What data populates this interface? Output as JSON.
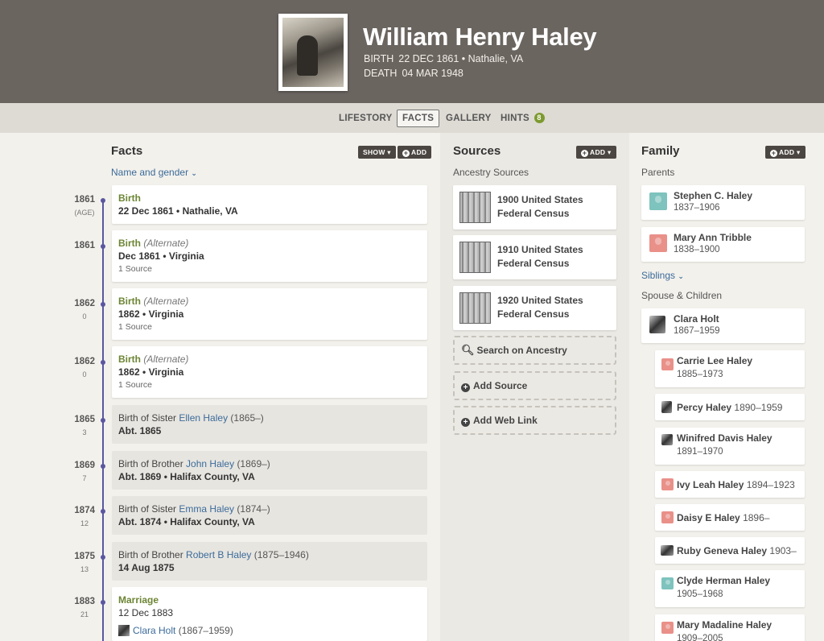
{
  "person": {
    "name": "William Henry Haley",
    "birth_label": "BIRTH",
    "birth_value": "22 DEC 1861 • Nathalie, VA",
    "death_label": "DEATH",
    "death_value": "04 MAR 1948"
  },
  "tabs": [
    {
      "label": "LIFESTORY"
    },
    {
      "label": "FACTS"
    },
    {
      "label": "GALLERY"
    },
    {
      "label": "HINTS",
      "badge": "8"
    }
  ],
  "facts": {
    "title": "Facts",
    "show_label": "SHOW ▾",
    "add_label": "ADD",
    "name_gender_link": "Name and gender",
    "items": [
      {
        "year": "1861",
        "age": "(AGE)",
        "title": "Birth",
        "alt": "",
        "value": "22 Dec 1861 • Nathalie, VA",
        "source": ""
      },
      {
        "year": "1861",
        "age": "",
        "title": "Birth",
        "alt": "(Alternate)",
        "value": "Dec 1861 • Virginia",
        "source": "1 Source"
      },
      {
        "year": "1862",
        "age": "0",
        "title": "Birth",
        "alt": "(Alternate)",
        "value": "1862 • Virginia",
        "source": "1 Source"
      },
      {
        "year": "1862",
        "age": "0",
        "title": "Birth",
        "alt": "(Alternate)",
        "value": "1862 • Virginia",
        "source": "1 Source"
      },
      {
        "year": "1865",
        "age": "3",
        "prefix": "Birth of Sister",
        "person": "Ellen Haley",
        "dates": "(1865–)",
        "value": "Abt. 1865"
      },
      {
        "year": "1869",
        "age": "7",
        "prefix": "Birth of Brother",
        "person": "John Haley",
        "dates": "(1869–)",
        "value": "Abt. 1869 • Halifax County, VA"
      },
      {
        "year": "1874",
        "age": "12",
        "prefix": "Birth of Sister",
        "person": "Emma Haley",
        "dates": "(1874–)",
        "value": "Abt. 1874 • Halifax County, VA"
      },
      {
        "year": "1875",
        "age": "13",
        "prefix": "Birth of Brother",
        "person": "Robert B Haley",
        "dates": "(1875–1946)",
        "value": "14 Aug 1875"
      },
      {
        "year": "1883",
        "age": "21",
        "title": "Marriage",
        "value": "12 Dec 1883",
        "spouse": "Clara Holt",
        "spouse_dates": "(1867–1959)"
      }
    ]
  },
  "sources": {
    "title": "Sources",
    "add_label": "ADD ▾",
    "subtitle": "Ancestry Sources",
    "items": [
      {
        "line1": "1900 United States",
        "line2": "Federal Census"
      },
      {
        "line1": "1910 United States",
        "line2": "Federal Census"
      },
      {
        "line1": "1920 United States",
        "line2": "Federal Census"
      }
    ],
    "search_label": "Search on Ancestry",
    "add_source_label": "Add Source",
    "add_web_link_label": "Add Web Link"
  },
  "family": {
    "title": "Family",
    "add_label": "ADD ▾",
    "parents_label": "Parents",
    "parents": [
      {
        "name": "Stephen C. Haley",
        "dates": "1837–1906",
        "gender": "m"
      },
      {
        "name": "Mary Ann Tribble",
        "dates": "1838–1900",
        "gender": "f"
      }
    ],
    "siblings_label": "Siblings",
    "spouse_children_label": "Spouse & Children",
    "spouse": {
      "name": "Clara Holt",
      "dates": "1867–1959"
    },
    "children": [
      {
        "name": "Carrie Lee Haley",
        "dates": "1885–1973"
      },
      {
        "name": "Percy Haley",
        "dates": "1890–1959"
      },
      {
        "name": "Winifred Davis Haley",
        "dates": "1891–1970"
      },
      {
        "name": "Ivy Leah Haley",
        "dates": "1894–1923"
      },
      {
        "name": "Daisy E Haley",
        "dates": "1896–"
      },
      {
        "name": "Ruby Geneva Haley",
        "dates": "1903–"
      },
      {
        "name": "Clyde Herman Haley",
        "dates": "1905–1968"
      },
      {
        "name": "Mary Madaline Haley",
        "dates": "1909–2005"
      }
    ]
  },
  "colors": {
    "header": "#6b6560",
    "timeline": "#5a56a0",
    "fact_green": "#6c8534",
    "link": "#3b6b9a"
  }
}
